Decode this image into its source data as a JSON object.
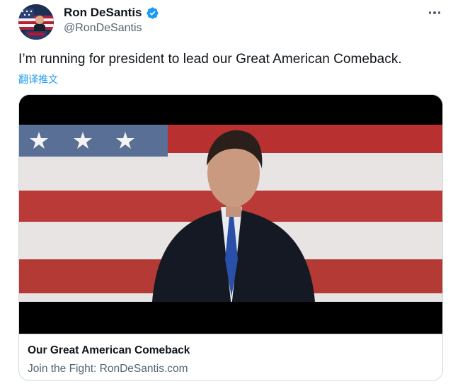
{
  "author": {
    "display_name": "Ron DeSantis",
    "handle": "@RonDeSantis",
    "verified": true
  },
  "tweet": {
    "text": "I’m running for president to lead our Great American Comeback.",
    "translate_label": "翻译推文"
  },
  "card": {
    "title": "Our Great American Comeback",
    "description": "Join the Fight: RonDeSantis.com"
  },
  "colors": {
    "accent": "#1d9bf0",
    "verified_badge": "#1d9bf0",
    "text_primary": "#0f1419",
    "text_secondary": "#536471",
    "border": "#cfd9de"
  },
  "icons": {
    "verified": "verified-badge-icon",
    "more": "more-options-icon"
  }
}
